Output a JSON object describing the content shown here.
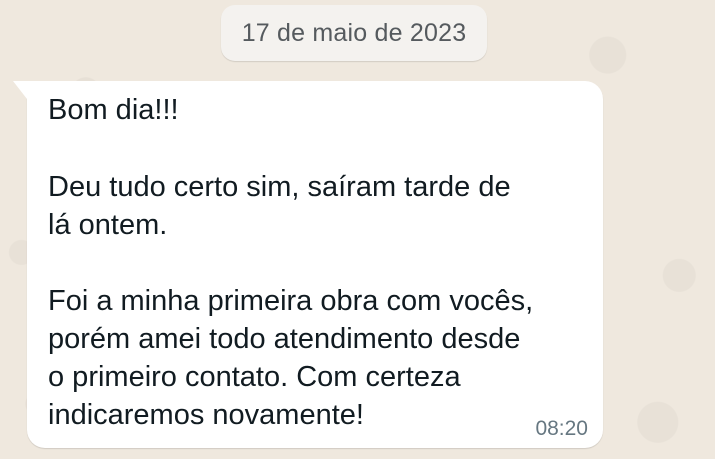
{
  "date_separator": "17 de maio de 2023",
  "message": {
    "lines": [
      "Bom dia!!!",
      "",
      "Deu tudo certo sim, saíram tarde de",
      "lá ontem.",
      "",
      "Foi a minha primeira obra com vocês,",
      "porém amei todo atendimento desde",
      "o primeiro contato. Com certeza",
      "indicaremos novamente!"
    ],
    "time": "08:20"
  },
  "colors": {
    "wallpaper": "#efe8de",
    "bubble": "#ffffff",
    "text": "#111b21",
    "meta_text": "#667781"
  }
}
